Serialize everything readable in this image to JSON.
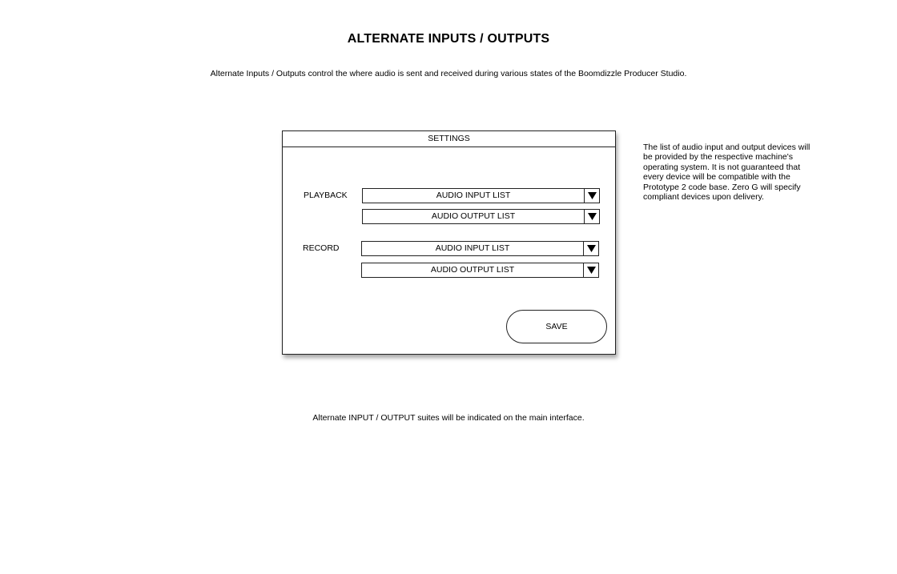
{
  "page": {
    "title": "ALTERNATE INPUTS / OUTPUTS",
    "intro": "Alternate Inputs / Outputs control the where audio is sent and received during various states of the Boomdizzle Producer Studio.",
    "footer_note": "Alternate INPUT / OUTPUT suites will be indicated on the main interface."
  },
  "settings": {
    "header": "SETTINGS",
    "playback": {
      "label": "PLAYBACK",
      "input_value": "AUDIO INPUT LIST",
      "output_value": "AUDIO OUTPUT LIST"
    },
    "record": {
      "label": "RECORD",
      "input_value": "AUDIO INPUT LIST",
      "output_value": "AUDIO OUTPUT LIST"
    },
    "save_label": "SAVE"
  },
  "side_note": "The list of audio input and output devices will be provided by the respective machine's operating system. It is not guaranteed that every device will be compatible with the Prototype 2 code base. Zero G will specify compliant devices upon delivery.",
  "icons": {
    "dropdown_arrow": "triangle-down-icon"
  }
}
